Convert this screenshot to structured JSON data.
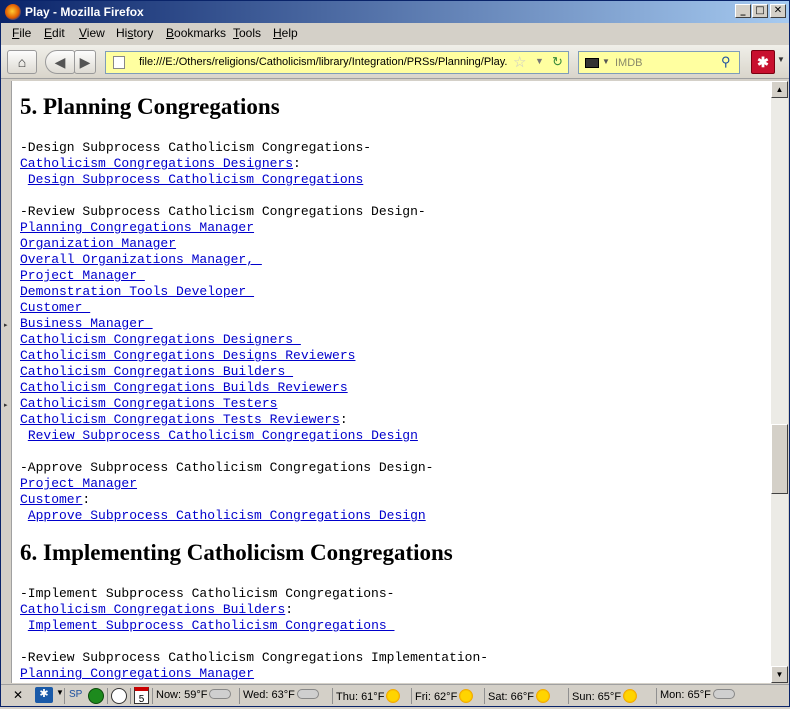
{
  "window": {
    "title": "Play - Mozilla Firefox",
    "controls": {
      "minimize": "_",
      "maximize": "□",
      "close": "✕"
    }
  },
  "menubar": {
    "items": [
      {
        "key": "F",
        "rest": "ile"
      },
      {
        "key": "E",
        "rest": "dit"
      },
      {
        "key": "V",
        "rest": "iew"
      },
      {
        "key": "",
        "pre": "Hi",
        "key2": "s",
        "rest": "tory"
      },
      {
        "key": "B",
        "rest": "ookmarks"
      },
      {
        "key": "T",
        "rest": "ools"
      },
      {
        "key": "H",
        "rest": "elp"
      }
    ]
  },
  "navbar": {
    "home_icon": "home-icon",
    "back_icon": "back-arrow-icon",
    "forward_icon": "forward-arrow-icon",
    "url": "file:///E:/Others/religions/Catholicism/library/Integration/PRSs/Planning/Play.",
    "search_placeholder": "IMDB",
    "addon_icon": "addon-red-icon",
    "url_bg": "#ffffa0"
  },
  "document": {
    "section5": {
      "heading": "5. Planning Congregations",
      "block1": {
        "title": "-Design Subprocess Catholicism Congregations-",
        "actor": "Catholicism Congregations Designers",
        "actor_suffix": ":",
        "link": "Design Subprocess Catholicism Congregations"
      },
      "block2": {
        "title": "-Review Subprocess Catholicism Congregations Design-",
        "actors": [
          "Planning Congregations Manager",
          "Organization Manager",
          "Overall Organizations Manager, ",
          "Project Manager ",
          "Demonstration Tools Developer ",
          "Customer ",
          "Business Manager ",
          "Catholicism Congregations Designers ",
          "Catholicism Congregations Designs Reviewers",
          "Catholicism Congregations Builders ",
          "Catholicism Congregations Builds Reviewers",
          "Catholicism Congregations Testers",
          "Catholicism Congregations Tests Reviewers"
        ],
        "actor_suffix": ":",
        "link": "Review Subprocess Catholicism Congregations Design"
      },
      "block3": {
        "title": "-Approve Subprocess Catholicism Congregations Design-",
        "actors": [
          "Project Manager",
          "Customer"
        ],
        "actor_suffix": ":",
        "link": "Approve Subprocess Catholicism Congregations Design"
      }
    },
    "section6": {
      "heading": "6. Implementing Catholicism Congregations",
      "block1": {
        "title": "-Implement Subprocess Catholicism Congregations-",
        "actor": "Catholicism Congregations Builders",
        "actor_suffix": ":",
        "link": "Implement Subprocess Catholicism Congregations "
      },
      "block2": {
        "title": "-Review Subprocess Catholicism Congregations Implementation-",
        "actor": "Planning Congregations Manager"
      }
    }
  },
  "statusbar": {
    "items": [
      "SP"
    ],
    "calendar_day": "5",
    "forecast": [
      {
        "label": "Now: 59°F",
        "icon": "cloud"
      },
      {
        "label": "Wed: 63°F",
        "icon": "cloud"
      },
      {
        "label": "Thu: 61°F",
        "icon": "sun"
      },
      {
        "label": "Fri: 62°F",
        "icon": "sun"
      },
      {
        "label": "Sat: 66°F",
        "icon": "sun"
      },
      {
        "label": "Sun: 65°F",
        "icon": "sun"
      },
      {
        "label": "Mon: 65°F",
        "icon": "cloud"
      }
    ]
  }
}
